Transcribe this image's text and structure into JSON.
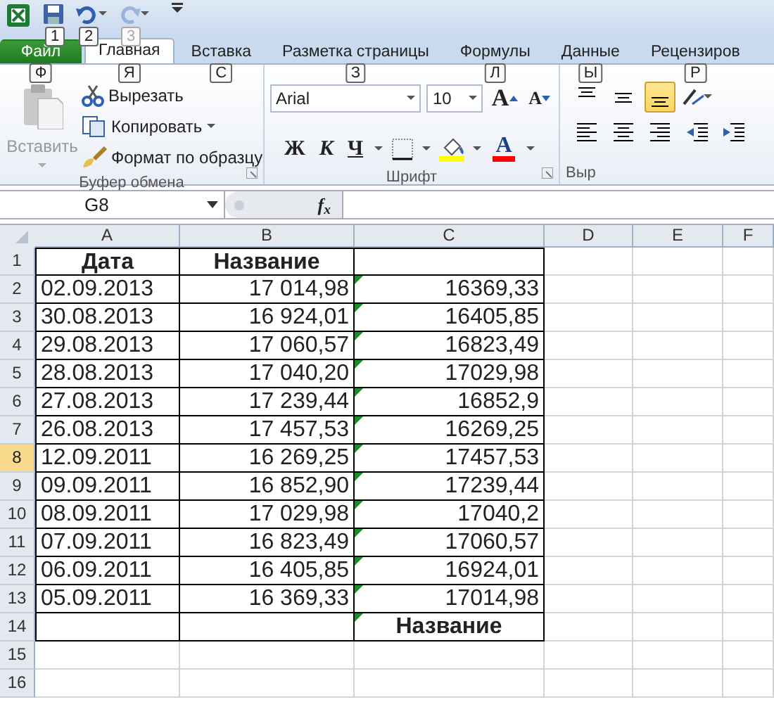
{
  "quick_access": [
    {
      "kind": "save",
      "keytip": "1",
      "disabled": false
    },
    {
      "kind": "undo",
      "keytip": "2",
      "disabled": false
    },
    {
      "kind": "redo",
      "keytip": "3",
      "disabled": true
    }
  ],
  "tabs": [
    {
      "label": "Файл",
      "keytip": "Ф",
      "kind": "file",
      "selected": false
    },
    {
      "label": "Главная",
      "keytip": "Я",
      "kind": "tab",
      "selected": true
    },
    {
      "label": "Вставка",
      "keytip": "С",
      "kind": "tab",
      "selected": false
    },
    {
      "label": "Разметка страницы",
      "keytip": "З",
      "kind": "tab",
      "selected": false
    },
    {
      "label": "Формулы",
      "keytip": "Л",
      "kind": "tab",
      "selected": false
    },
    {
      "label": "Данные",
      "keytip": "Ы",
      "kind": "tab",
      "selected": false
    },
    {
      "label": "Рецензиров",
      "keytip": "Р",
      "kind": "tab",
      "selected": false
    }
  ],
  "clipboard": {
    "paste_label": "Вставить",
    "paste_disabled": true,
    "cut": "Вырезать",
    "copy": "Копировать",
    "format_painter": "Формат по образцу",
    "group_label": "Буфер обмена"
  },
  "font": {
    "name": "Arial",
    "size": "10",
    "grow": "A",
    "shrink": "A",
    "bold": "Ж",
    "italic": "К",
    "underline": "Ч",
    "color_letter": "A",
    "group_label": "Шрифт"
  },
  "alignment": {
    "vertical": [
      {
        "kind": "top",
        "selected": false
      },
      {
        "kind": "middle",
        "selected": false
      },
      {
        "kind": "bottom",
        "selected": true
      }
    ],
    "group_label": "Выр"
  },
  "name_box": "G8",
  "function_label": "f$_{x}$",
  "columns": [
    {
      "label": "A",
      "selected": false
    },
    {
      "label": "B",
      "selected": false
    },
    {
      "label": "C",
      "selected": false
    },
    {
      "label": "D",
      "selected": false
    },
    {
      "label": "E",
      "selected": false
    },
    {
      "label": "F",
      "selected": false
    }
  ],
  "rows": [
    {
      "header": "1",
      "selected": false,
      "bordered": true,
      "cells": [
        {
          "text": "Дата",
          "bold": true
        },
        {
          "text": "Название",
          "bold": true
        },
        {}
      ]
    },
    {
      "header": "2",
      "selected": false,
      "bordered": true,
      "cells": [
        {
          "text": "02.09.2013"
        },
        {
          "text": "17 014,98"
        },
        {
          "text": "16369,33",
          "flag": true
        }
      ]
    },
    {
      "header": "3",
      "selected": false,
      "bordered": true,
      "cells": [
        {
          "text": "30.08.2013"
        },
        {
          "text": "16 924,01"
        },
        {
          "text": "16405,85",
          "flag": true
        }
      ]
    },
    {
      "header": "4",
      "selected": false,
      "bordered": true,
      "cells": [
        {
          "text": "29.08.2013"
        },
        {
          "text": "17 060,57"
        },
        {
          "text": "16823,49",
          "flag": true
        }
      ]
    },
    {
      "header": "5",
      "selected": false,
      "bordered": true,
      "cells": [
        {
          "text": "28.08.2013"
        },
        {
          "text": "17 040,20"
        },
        {
          "text": "17029,98",
          "flag": true
        }
      ]
    },
    {
      "header": "6",
      "selected": false,
      "bordered": true,
      "cells": [
        {
          "text": "27.08.2013"
        },
        {
          "text": "17 239,44"
        },
        {
          "text": "16852,9",
          "flag": true
        }
      ]
    },
    {
      "header": "7",
      "selected": false,
      "bordered": true,
      "cells": [
        {
          "text": "26.08.2013"
        },
        {
          "text": "17 457,53"
        },
        {
          "text": "16269,25",
          "flag": true
        }
      ]
    },
    {
      "header": "8",
      "selected": true,
      "bordered": true,
      "cells": [
        {
          "text": "12.09.2011"
        },
        {
          "text": "16 269,25"
        },
        {
          "text": "17457,53",
          "flag": true
        }
      ]
    },
    {
      "header": "9",
      "selected": false,
      "bordered": true,
      "cells": [
        {
          "text": "09.09.2011"
        },
        {
          "text": "16 852,90"
        },
        {
          "text": "17239,44",
          "flag": true
        }
      ]
    },
    {
      "header": "10",
      "selected": false,
      "bordered": true,
      "cells": [
        {
          "text": "08.09.2011"
        },
        {
          "text": "17 029,98"
        },
        {
          "text": "17040,2",
          "flag": true
        }
      ]
    },
    {
      "header": "11",
      "selected": false,
      "bordered": true,
      "cells": [
        {
          "text": "07.09.2011"
        },
        {
          "text": "16 823,49"
        },
        {
          "text": "17060,57",
          "flag": true
        }
      ]
    },
    {
      "header": "12",
      "selected": false,
      "bordered": true,
      "cells": [
        {
          "text": "06.09.2011"
        },
        {
          "text": "16 405,85"
        },
        {
          "text": "16924,01",
          "flag": true
        }
      ]
    },
    {
      "header": "13",
      "selected": false,
      "bordered": true,
      "cells": [
        {
          "text": "05.09.2011"
        },
        {
          "text": "16 369,33"
        },
        {
          "text": "17014,98",
          "flag": true
        }
      ]
    },
    {
      "header": "14",
      "selected": false,
      "bordered": true,
      "cells": [
        {},
        {},
        {
          "text": "Название",
          "bold": true,
          "flag": true
        }
      ]
    },
    {
      "header": "15",
      "selected": false,
      "bordered": false,
      "cells": [
        {},
        {},
        {}
      ]
    },
    {
      "header": "16",
      "selected": false,
      "bordered": false,
      "cells": [
        {},
        {},
        {}
      ]
    }
  ]
}
